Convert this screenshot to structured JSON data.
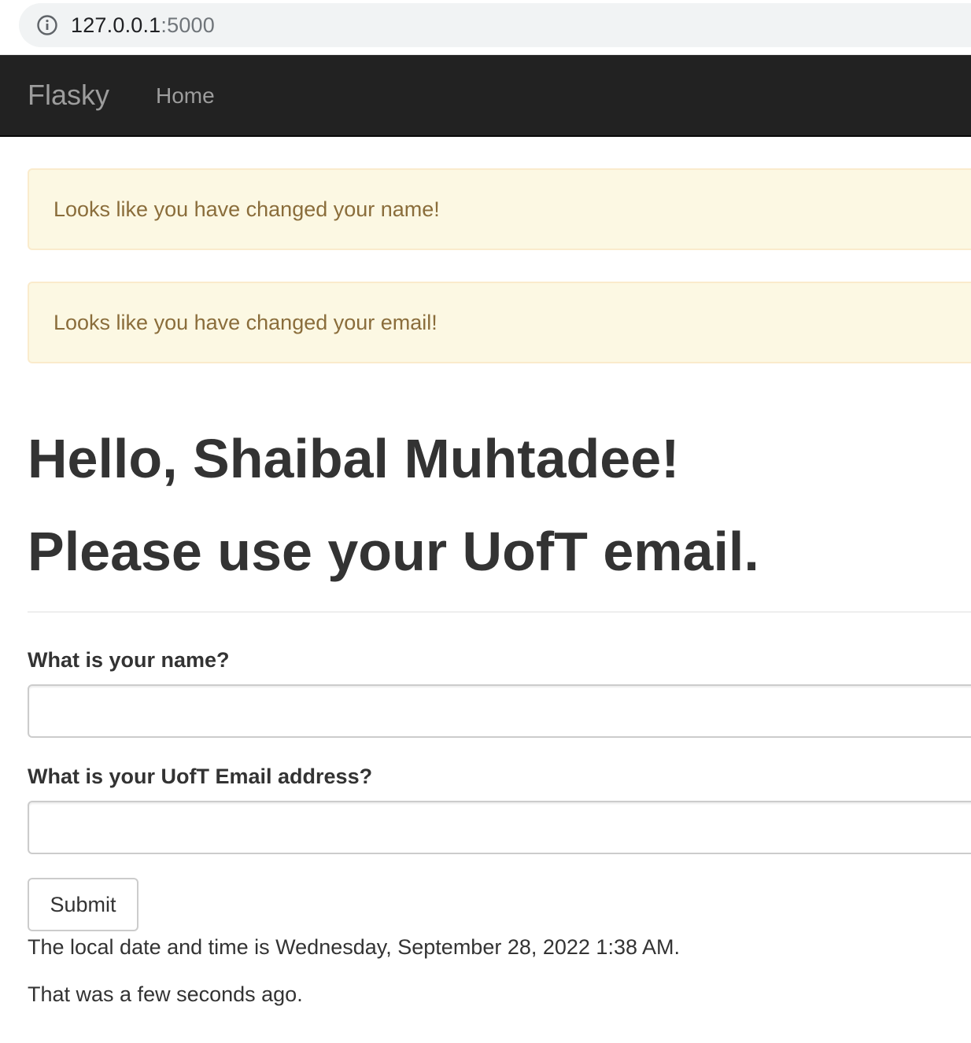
{
  "browser": {
    "url_host": "127.0.0.1",
    "url_port": ":5000",
    "info_icon": "info-circle-icon"
  },
  "navbar": {
    "brand": "Flasky",
    "home_label": "Home",
    "background": "#222222",
    "text_color": "#9d9d9d"
  },
  "alerts": [
    {
      "message": "Looks like you have changed your name!"
    },
    {
      "message": "Looks like you have changed your email!"
    }
  ],
  "alert_colors": {
    "background": "#fcf8e3",
    "border": "#faebcc",
    "text": "#8a6d3b"
  },
  "page": {
    "greeting": "Hello, Shaibal Muhtadee!",
    "notice": "Please use your UofT email."
  },
  "form": {
    "name_label": "What is your name?",
    "name_value": "",
    "email_label": "What is your UofT Email address?",
    "email_value": "",
    "submit_label": "Submit"
  },
  "footer": {
    "datetime_text": "The local date and time is Wednesday, September 28, 2022 1:38 AM.",
    "relative_text": "That was a few seconds ago."
  }
}
